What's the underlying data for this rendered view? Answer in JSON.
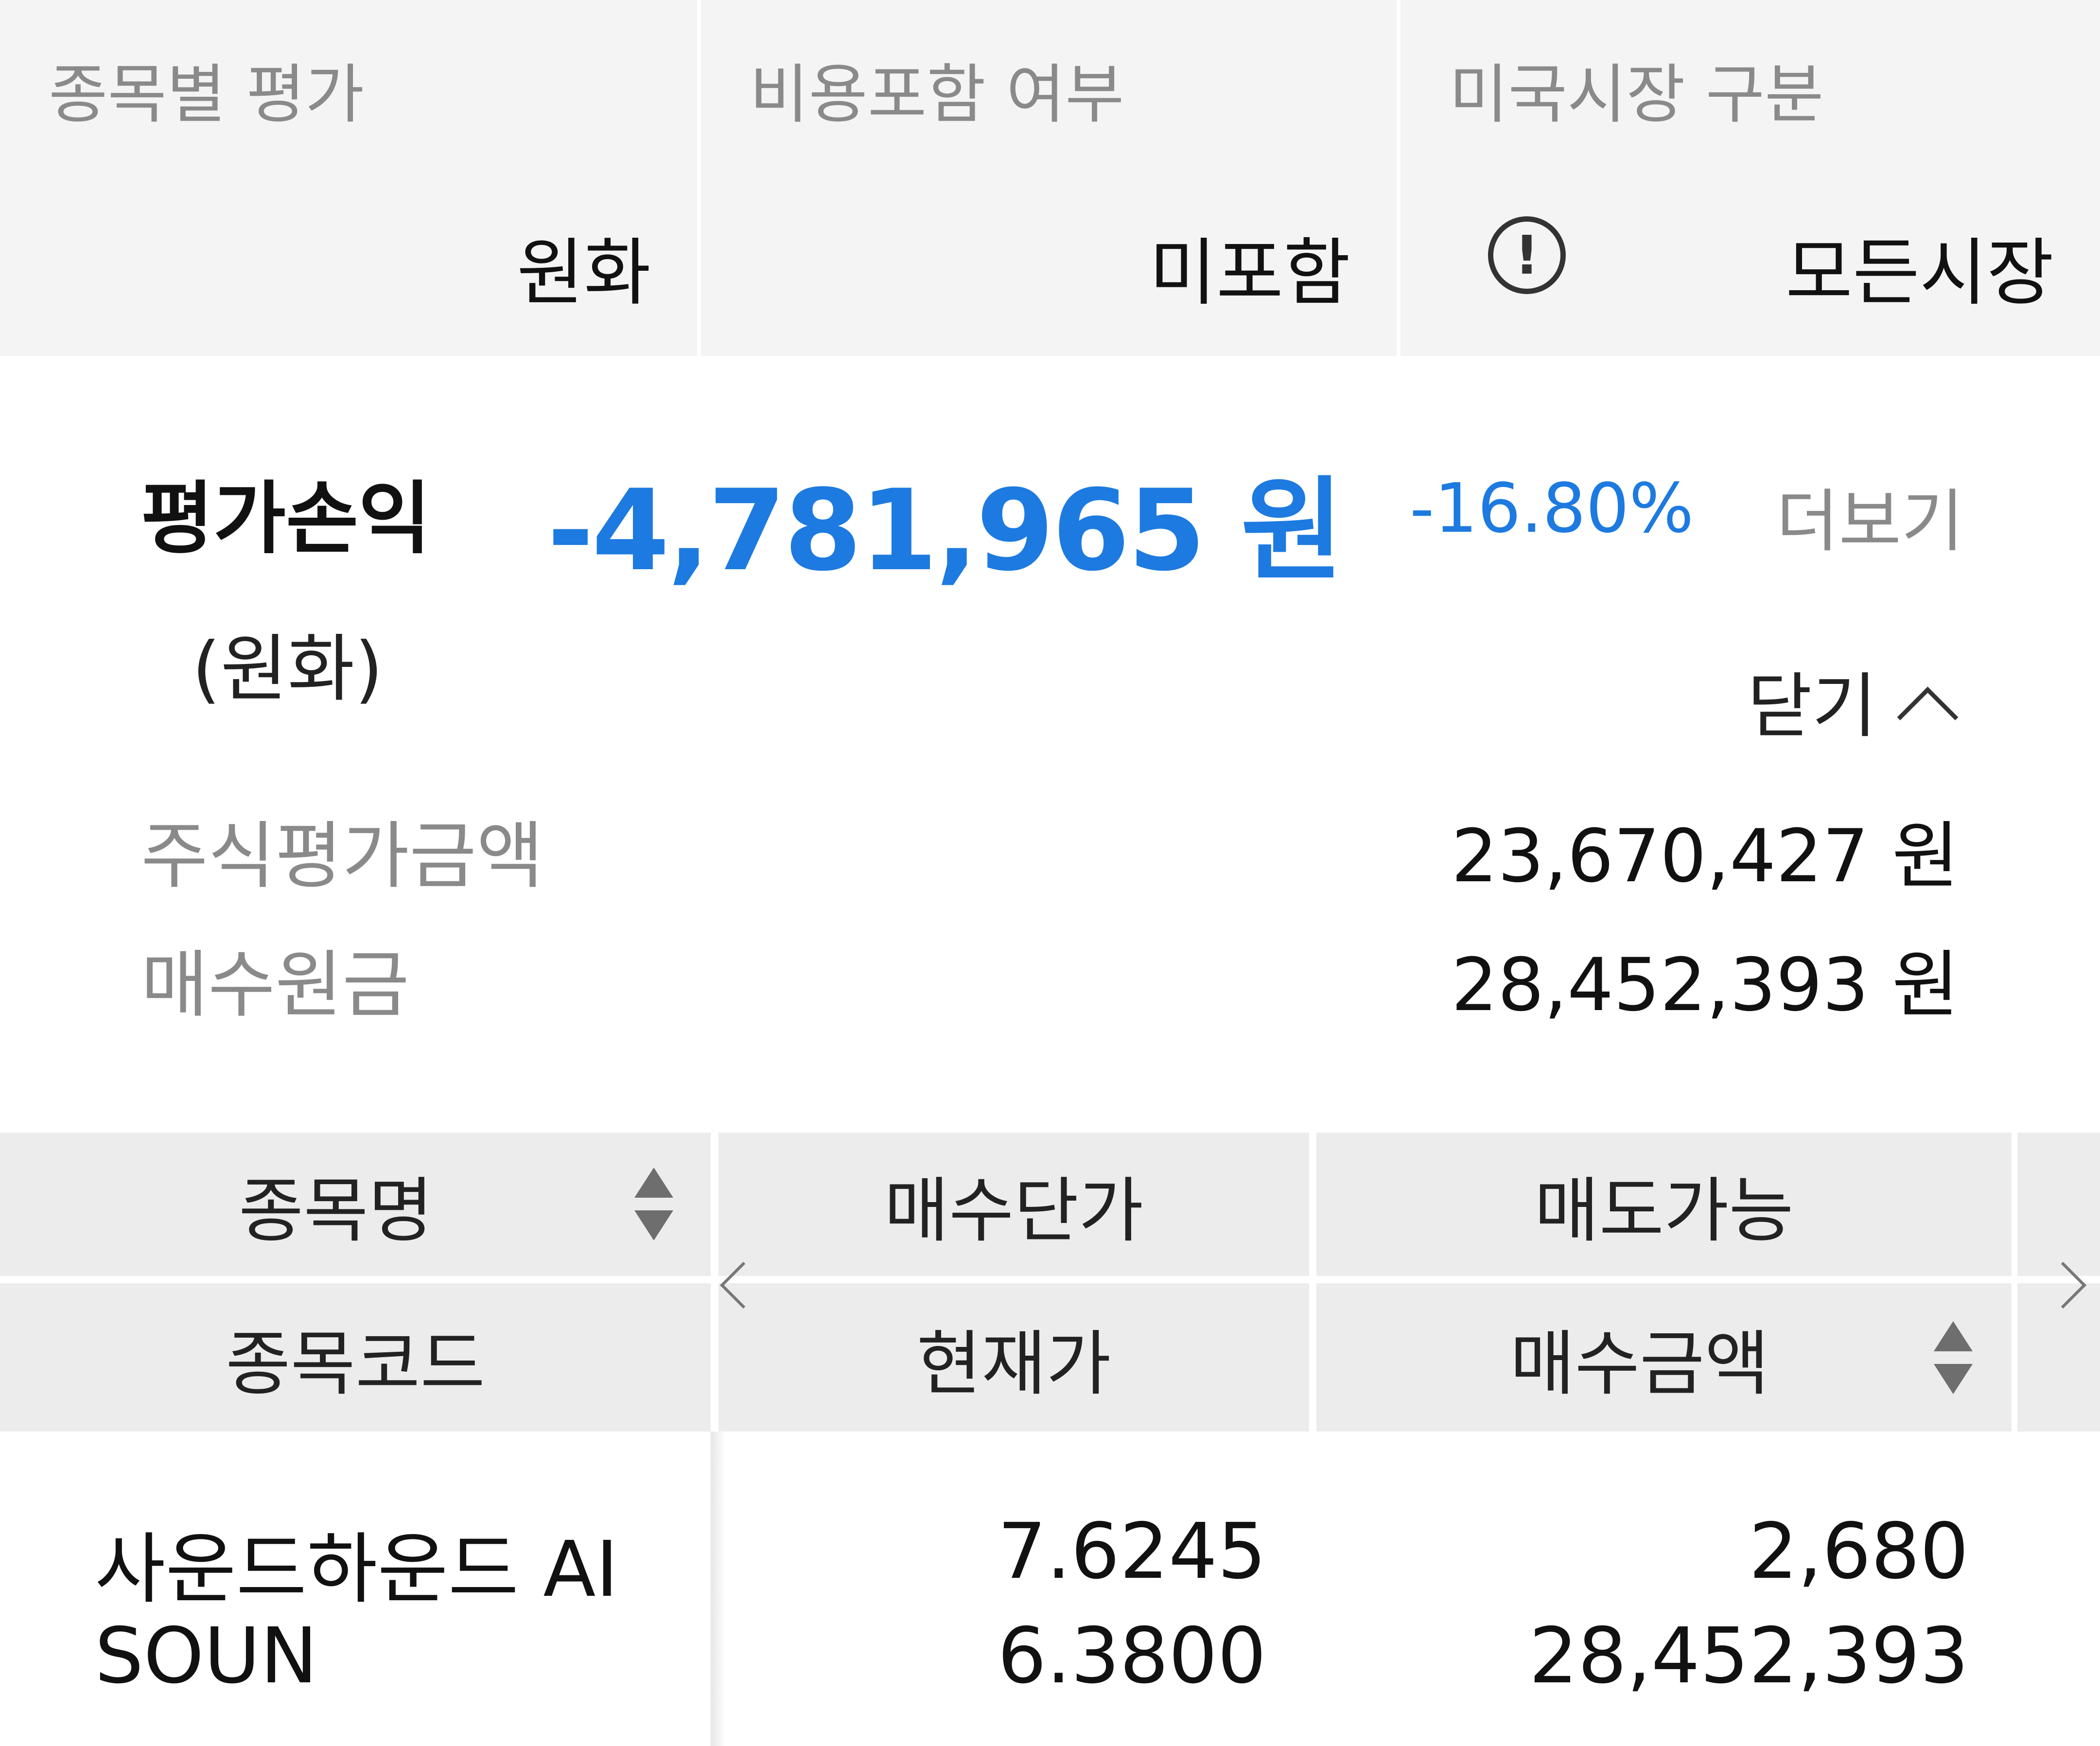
{
  "filters": [
    {
      "title": "종목별 평가",
      "value": "원화"
    },
    {
      "title": "비용포함 여부",
      "value": "미포함"
    },
    {
      "title": "미국시장 구분",
      "value": "모든시장",
      "icon": "info-icon"
    }
  ],
  "summary": {
    "label": "평가손익",
    "sub_label": "(원화)",
    "amount": "-4,781,965 원",
    "rate": "-16.80%",
    "more": "더보기",
    "close": "닫기",
    "accent_color": "#1d7ae0"
  },
  "details": [
    {
      "label": "주식평가금액",
      "value": "23,670,427 원"
    },
    {
      "label": "매수원금",
      "value": "28,452,393 원"
    }
  ],
  "table": {
    "headers": {
      "name": "종목명",
      "code": "종목코드",
      "buy_price": "매수단가",
      "current_price": "현재가",
      "sellable": "매도가능",
      "buy_amount": "매수금액"
    },
    "rows": [
      {
        "name": "사운드하운드 AI",
        "code": "SOUN",
        "buy_price": "7.6245",
        "current_price": "6.3800",
        "sellable": "2,680",
        "buy_amount": "28,452,393"
      }
    ]
  }
}
